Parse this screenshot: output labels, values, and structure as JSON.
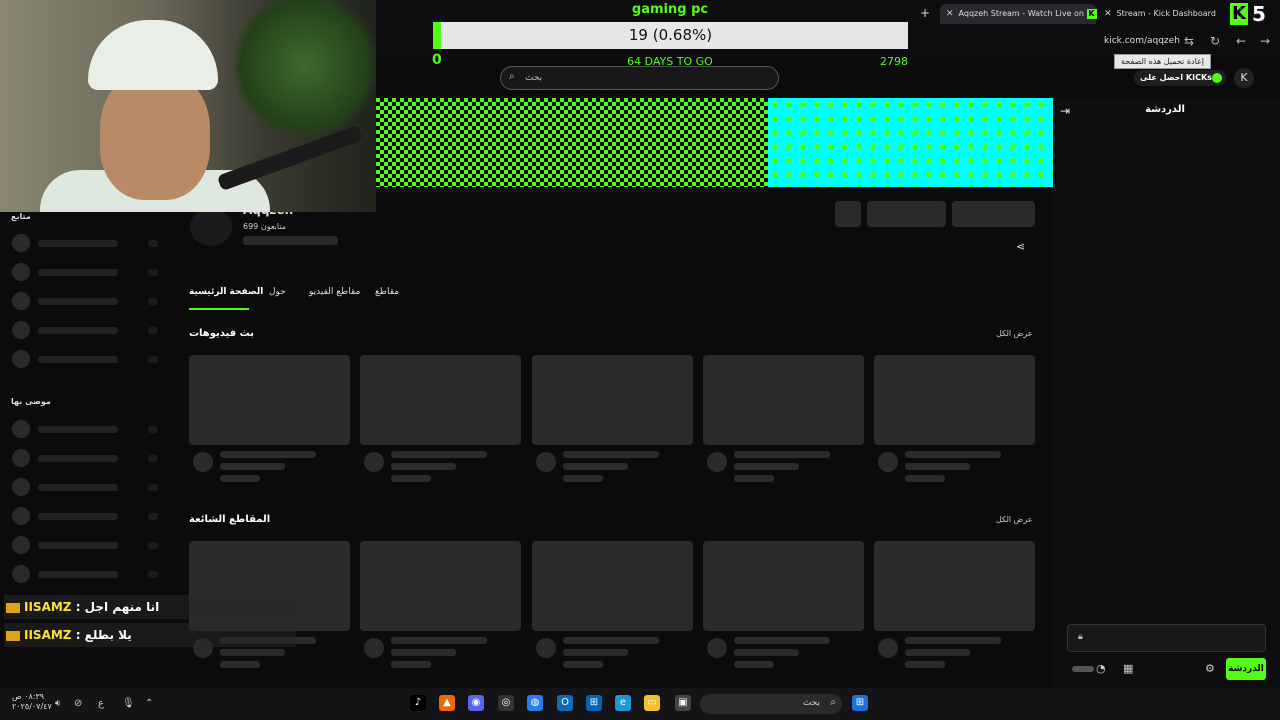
{
  "browser": {
    "tabs": [
      {
        "label": "Aqqzeh Stream - Watch Live on",
        "active": true
      },
      {
        "label": "Stream - Kick Dashboard",
        "active": false
      }
    ],
    "new_tab": "+",
    "url": "kick.com/aqqzeh",
    "tooltip": "إعادة تحميل هذه الصفحة",
    "overlay_badge": "5"
  },
  "goal": {
    "title": "gaming pc",
    "progress_text": "19 (0.68%)",
    "progress": 0.0068,
    "min": "0",
    "days_left": "64 DAYS TO GO",
    "max": "2798"
  },
  "kick": {
    "search_placeholder": "بحث",
    "get_kicks": "احصل على KICKs",
    "chat_title": "الدردشة",
    "chat_button": "الدردشة",
    "channel_name": "Aqqzeh",
    "followers": "699 متابعون",
    "tabs": [
      "الصفحة الرئيسية",
      "حول",
      "مقاطع الفيديو",
      "مقاطع"
    ],
    "section_1": "بث فيديوهات",
    "section_2": "المقاطع الشائعة",
    "see_all": "عرض الكل",
    "sidebar_heading_1": "متابع",
    "sidebar_heading_2": "موصى بها",
    "brand_green": "#53fc18"
  },
  "overlay_chat": [
    {
      "user": "IISAMZ",
      "message": "انا منهم اجل"
    },
    {
      "user": "IISAMZ",
      "message": "يلا بطلع"
    }
  ],
  "taskbar": {
    "search": "بحث",
    "time": "٠٨:٣٩ ص",
    "date": "٢٠٢٥/٠٧/٤٧",
    "lang": "ع"
  }
}
